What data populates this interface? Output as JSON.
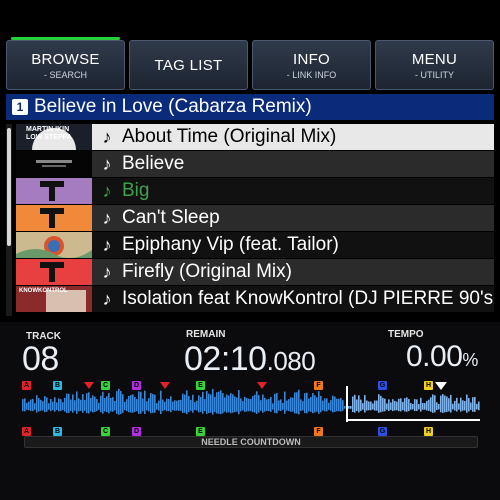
{
  "tabs": [
    {
      "label": "BROWSE",
      "sub": "- SEARCH",
      "active": true
    },
    {
      "label": "TAG LIST",
      "sub": ""
    },
    {
      "label": "INFO",
      "sub": "- LINK INFO"
    },
    {
      "label": "MENU",
      "sub": "- UTILITY"
    }
  ],
  "playlist": {
    "deck": "1",
    "title": "Believe in Love (Cabarza Remix)"
  },
  "tracks": [
    {
      "title": "About Time (Original Mix)",
      "art": "martin-ikin-cover",
      "art_text": "MARTIN IKIN\nLOW STEPPA",
      "state": "selected"
    },
    {
      "title": "Believe",
      "art": "black-cover",
      "state": "normal"
    },
    {
      "title": "Big",
      "art": "purple-t-cover",
      "state": "played"
    },
    {
      "title": "Can't Sleep",
      "art": "orange-t-cover",
      "state": "normal"
    },
    {
      "title": "Epiphany Vip (feat. Tailor)",
      "art": "swirl-cover",
      "state": "normal"
    },
    {
      "title": "Firefly (Original Mix)",
      "art": "red-t-cover",
      "state": "normal"
    },
    {
      "title": "Isolation feat KnowKontrol (DJ PIERRE 90's",
      "art": "photo-cover",
      "art_text": "KNOWKONTROL",
      "state": "normal"
    }
  ],
  "info": {
    "track_label": "TRACK",
    "track_number": "08",
    "remain_label": "REMAIN",
    "remain_main": "02:10",
    "remain_ms": ".080",
    "tempo_label": "TEMPO",
    "tempo_value": "0.00",
    "tempo_unit": "%",
    "needle_label": "NEEDLE COUNTDOWN"
  },
  "hot_cues": [
    {
      "letter": "A",
      "color": "#e1222b"
    },
    {
      "letter": "B",
      "color": "#2fb9e0"
    },
    {
      "letter": "C",
      "color": "#36d33a"
    },
    {
      "letter": "D",
      "color": "#b12fe0"
    },
    {
      "letter": "E",
      "color": "#36d33a"
    },
    {
      "letter": "F",
      "color": "#f07a1a"
    },
    {
      "letter": "G",
      "color": "#2b4fe0"
    },
    {
      "letter": "H",
      "color": "#f0d020"
    }
  ],
  "colors": {
    "waveform": "#3a86d8",
    "accent_green": "#27d03a",
    "header_blue": "#0a2a7a"
  }
}
